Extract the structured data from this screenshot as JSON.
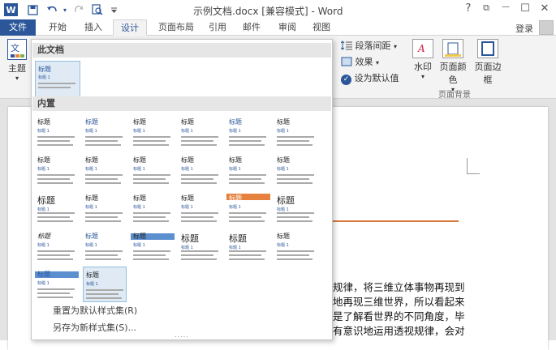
{
  "titlebar": {
    "logo": "W",
    "title": "示例文档.docx [兼容模式] - Word",
    "help": "?",
    "restore": "⧉",
    "minimize": "—",
    "maximize": "☐",
    "close": "✕"
  },
  "tabs": [
    "文件",
    "开始",
    "插入",
    "设计",
    "页面布局",
    "引用",
    "邮件",
    "审阅",
    "视图"
  ],
  "active_tab": "设计",
  "login": "登录",
  "ribbon": {
    "theme_label": "主题",
    "theme_arrow": "▾",
    "paragraph_spacing": "段落间距",
    "effects": "效果",
    "set_default": "设为默认值",
    "dropdown_arrow": "▾",
    "checkmark": "✓",
    "watermark": "水印",
    "page_color": "页面颜色",
    "page_border": "页面边框",
    "group_page_background": "页面背景"
  },
  "dropdown": {
    "section_this_doc": "此文档",
    "section_builtin": "内置",
    "thumb_title": "标题",
    "thumb_heading1": "标题 1",
    "reset": "重置为默认样式集(R)",
    "save_as": "另存为新样式集(S)...",
    "resize_grip": "....."
  },
  "document": {
    "line1": "规律，将三维立体事物再现到",
    "line2": "地再现三维世界，所以看起来",
    "line3": "是了解看世界的不同角度，毕",
    "line4": "有意识地运用透视规律，会对"
  },
  "colors": {
    "accent": "#2b579a",
    "orange_rule": "#d87a3a"
  }
}
